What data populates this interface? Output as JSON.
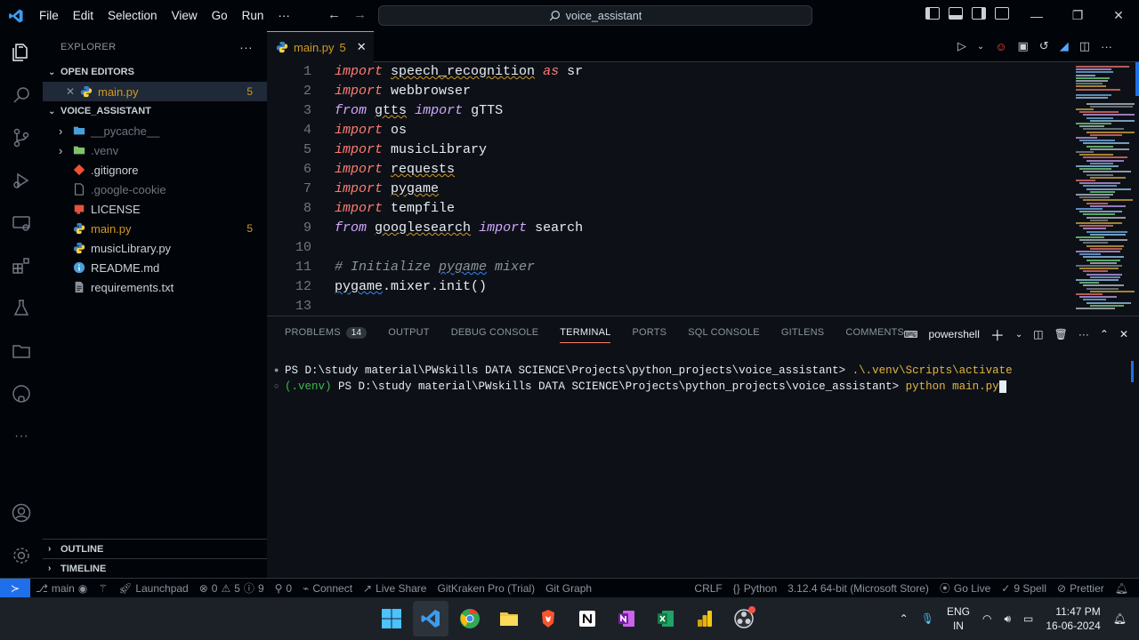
{
  "titlebar": {
    "menu": [
      "File",
      "Edit",
      "Selection",
      "View",
      "Go",
      "Run",
      "···"
    ],
    "search_text": "voice_assistant",
    "window_controls": [
      "minimize",
      "restore",
      "close"
    ]
  },
  "sidebar": {
    "title": "EXPLORER",
    "open_editors_label": "OPEN EDITORS",
    "open_editors": [
      {
        "name": "main.py",
        "badge": "5"
      }
    ],
    "project_label": "VOICE_ASSISTANT",
    "files": [
      {
        "name": "__pycache__",
        "type": "folder",
        "dim": true,
        "icon": "folder-python-icon"
      },
      {
        "name": ".venv",
        "type": "folder",
        "dim": true,
        "icon": "folder-venv-icon"
      },
      {
        "name": ".gitignore",
        "type": "file",
        "dim": false,
        "icon": "git-icon"
      },
      {
        "name": ".google-cookie",
        "type": "file",
        "dim": true,
        "icon": "file-icon"
      },
      {
        "name": "LICENSE",
        "type": "file",
        "dim": false,
        "icon": "license-icon"
      },
      {
        "name": "main.py",
        "type": "file",
        "dim": false,
        "warn": true,
        "badge": "5",
        "icon": "python-icon"
      },
      {
        "name": "musicLibrary.py",
        "type": "file",
        "dim": false,
        "icon": "python-icon"
      },
      {
        "name": "README.md",
        "type": "file",
        "dim": false,
        "icon": "info-icon"
      },
      {
        "name": "requirements.txt",
        "type": "file",
        "dim": false,
        "icon": "text-file-icon"
      }
    ],
    "outline_label": "OUTLINE",
    "timeline_label": "TIMELINE"
  },
  "editor": {
    "tab_name": "main.py",
    "tab_badge": "5",
    "lines": [
      {
        "n": "1",
        "tokens": [
          [
            "kw",
            "import"
          ],
          [
            "t",
            " "
          ],
          [
            "sq",
            "speech_recognition"
          ],
          [
            "t",
            " "
          ],
          [
            "kw",
            "as"
          ],
          [
            "t",
            " sr"
          ]
        ]
      },
      {
        "n": "2",
        "tokens": [
          [
            "kw",
            "import"
          ],
          [
            "t",
            " webbrowser"
          ]
        ]
      },
      {
        "n": "3",
        "tokens": [
          [
            "kw2",
            "from"
          ],
          [
            "t",
            " "
          ],
          [
            "sq",
            "gtts"
          ],
          [
            "t",
            " "
          ],
          [
            "kw2",
            "import"
          ],
          [
            "t",
            " gTTS"
          ]
        ]
      },
      {
        "n": "4",
        "tokens": [
          [
            "kw",
            "import"
          ],
          [
            "t",
            " os"
          ]
        ]
      },
      {
        "n": "5",
        "tokens": [
          [
            "kw",
            "import"
          ],
          [
            "t",
            " musicLibrary"
          ]
        ]
      },
      {
        "n": "6",
        "tokens": [
          [
            "kw",
            "import"
          ],
          [
            "t",
            " "
          ],
          [
            "sq",
            "requests"
          ]
        ]
      },
      {
        "n": "7",
        "tokens": [
          [
            "kw",
            "import"
          ],
          [
            "t",
            " "
          ],
          [
            "sq",
            "pygame"
          ]
        ]
      },
      {
        "n": "8",
        "tokens": [
          [
            "kw",
            "import"
          ],
          [
            "t",
            " tempfile"
          ]
        ]
      },
      {
        "n": "9",
        "tokens": [
          [
            "kw2",
            "from"
          ],
          [
            "t",
            " "
          ],
          [
            "sq",
            "googlesearch"
          ],
          [
            "t",
            " "
          ],
          [
            "kw2",
            "import"
          ],
          [
            "t",
            " search"
          ]
        ]
      },
      {
        "n": "10",
        "tokens": []
      },
      {
        "n": "11",
        "tokens": [
          [
            "cmt",
            "# Initialize "
          ],
          [
            "cmtsq",
            "pygame"
          ],
          [
            "cmt",
            " mixer"
          ]
        ]
      },
      {
        "n": "12",
        "tokens": [
          [
            "sqb",
            "pygame"
          ],
          [
            "t",
            ".mixer.init()"
          ]
        ]
      },
      {
        "n": "13",
        "tokens": []
      }
    ]
  },
  "panel": {
    "tabs": [
      "PROBLEMS",
      "OUTPUT",
      "DEBUG CONSOLE",
      "TERMINAL",
      "PORTS",
      "SQL CONSOLE",
      "GITLENS",
      "COMMENTS"
    ],
    "active_tab": "TERMINAL",
    "problems_count": "14",
    "shell_label": "powershell",
    "terminal_lines": [
      {
        "dot": "●",
        "prompt": "PS D:\\study material\\PWskills DATA SCIENCE\\Projects\\python_projects\\voice_assistant> ",
        "cmd": ".\\.venv\\Scripts\\activate",
        "venv": ""
      },
      {
        "dot": "○",
        "prompt": " PS D:\\study material\\PWskills DATA SCIENCE\\Projects\\python_projects\\voice_assistant> ",
        "cmd": "python main.py",
        "venv": "(.venv)"
      }
    ]
  },
  "statusbar": {
    "branch": "main",
    "launchpad": "Launchpad",
    "errors": "0",
    "warnings": "5",
    "infos": "9",
    "ports": "0",
    "connect": "Connect",
    "live_share": "Live Share",
    "gitkraken": "GitKraken Pro (Trial)",
    "git_graph": "Git Graph",
    "eol": "CRLF",
    "language": "Python",
    "interpreter": "3.12.4 64-bit (Microsoft Store)",
    "go_live": "Go Live",
    "spell": "9 Spell",
    "prettier": "Prettier"
  },
  "taskbar": {
    "lang_top": "ENG",
    "lang_bottom": "IN",
    "time": "11:47 PM",
    "date": "16-06-2024"
  },
  "colors": {
    "accent": "#1f6feb",
    "keyword": "#ff7b72",
    "keyword_from": "#d2a8ff",
    "warning": "#d29922",
    "venv": "#3fb950",
    "terminal_cmd": "#e3b341"
  }
}
